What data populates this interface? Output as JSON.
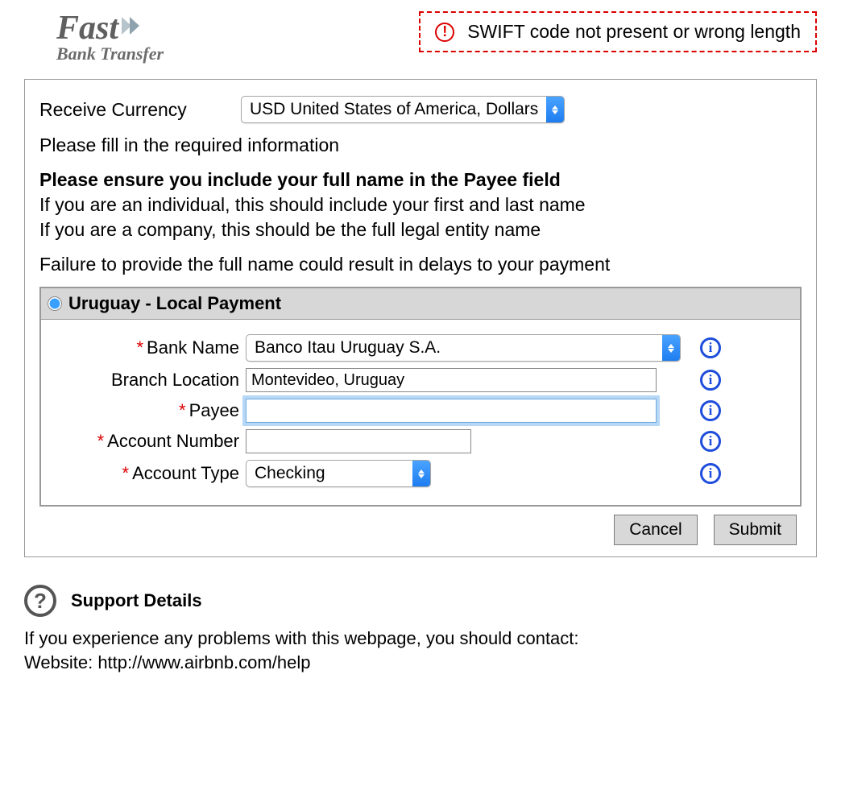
{
  "logo": {
    "line1": "Fast",
    "line2": "Bank Transfer"
  },
  "alert": {
    "text": "SWIFT code not present or wrong length"
  },
  "form": {
    "receive_currency_label": "Receive Currency",
    "receive_currency_value": "USD United States of America, Dollars",
    "fill_required_text": "Please fill in the required information",
    "ensure_bold": "Please ensure you include your full name in the Payee field",
    "ensure_line1": "If you are an individual, this should include your first and last name",
    "ensure_line2": "If you are a company, this should be the full legal entity name",
    "failure_bold": "Failure to provide the full name could result in delays to your payment"
  },
  "payment_section": {
    "title": "Uruguay - Local Payment",
    "fields": {
      "bank_name": {
        "label": "Bank Name",
        "value": "Banco Itau Uruguay S.A.",
        "required": true
      },
      "branch_location": {
        "label": "Branch Location",
        "value": "Montevideo, Uruguay",
        "required": false
      },
      "payee": {
        "label": "Payee",
        "value": "",
        "required": true
      },
      "account_number": {
        "label": "Account Number",
        "value": "",
        "required": true
      },
      "account_type": {
        "label": "Account Type",
        "value": "Checking",
        "required": true
      }
    }
  },
  "buttons": {
    "cancel": "Cancel",
    "submit": "Submit"
  },
  "support": {
    "title": "Support Details",
    "intro": "If you experience any problems with this webpage, you should contact:",
    "website_label": "Website: ",
    "website_url": "http://www.airbnb.com/help"
  }
}
